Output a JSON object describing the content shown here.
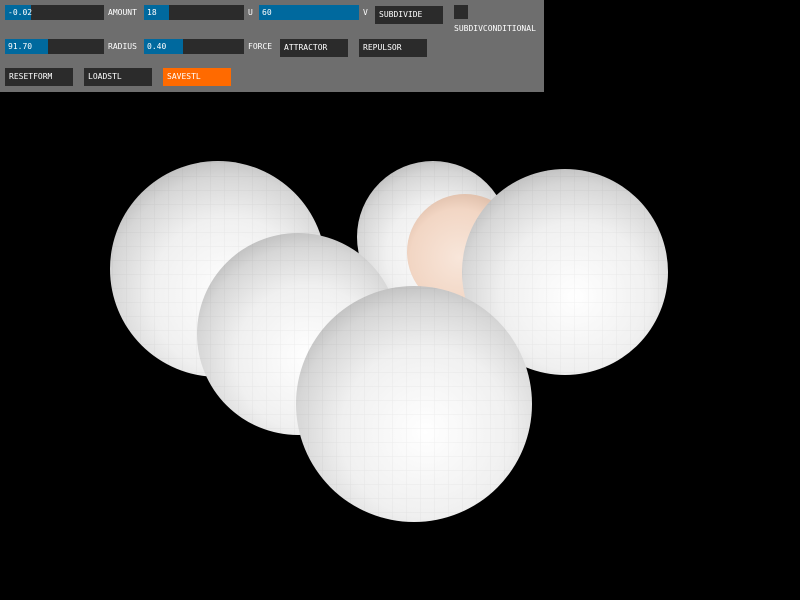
{
  "controls": {
    "amount": {
      "label": "AMOUNT",
      "value": "-0.02",
      "fill": 0.26
    },
    "radius": {
      "label": "RADIUS",
      "value": "91.70",
      "fill": 0.43
    },
    "u": {
      "label": "U",
      "value": "18",
      "fill": 0.25
    },
    "force": {
      "label": "FORCE",
      "value": "0.40",
      "fill": 0.39
    },
    "v": {
      "label": "V",
      "value": "60",
      "fill": 1.0
    },
    "subdivide_label": "SUBDIVIDE",
    "subdiv_conditional_label": "SUBDIVCONDITIONAL",
    "attractor_label": "ATTRACTOR",
    "repulsor_label": "REPULSOR",
    "resetform_label": "RESETFORM",
    "loadstl_label": "LOADSTL",
    "savestl_label": "SAVESTL"
  },
  "colors": {
    "panel_bg": "#6e6e6e",
    "control_bg": "#2b2b2b",
    "slider_fill": "#00699e",
    "active_button": "#ff6a00",
    "canvas_bg": "#000000",
    "sphere": "#f2f2f2",
    "attractor_sphere": "#f5dccc"
  }
}
